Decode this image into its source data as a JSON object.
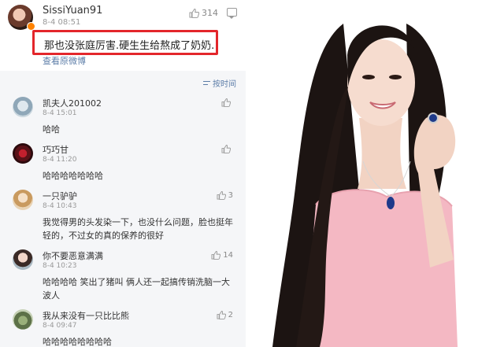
{
  "post": {
    "username": "SissiYuan91",
    "date": "8-4 08:51",
    "likes": "314",
    "content": "那也没张庭厉害.硬生生给熬成了奶奶.",
    "view_original": "查看原微博"
  },
  "sort": {
    "label": "按时间"
  },
  "comments": [
    {
      "name": "凯夫人201002",
      "date": "8-4 15:01",
      "text": "哈哈",
      "likes": ""
    },
    {
      "name": "巧巧甘",
      "date": "8-4 11:20",
      "text": "哈哈哈哈哈哈哈",
      "likes": ""
    },
    {
      "name": "一只驴驴",
      "date": "8-4 10:43",
      "text": "我觉得男的头发染一下，也没什么问题，脸也挺年轻的，不过女的真的保养的很好",
      "likes": "3"
    },
    {
      "name": "你不要恶意满满",
      "date": "8-4 10:23",
      "text": "哈哈哈哈 笑出了猪叫 俩人还一起搞传销洗脑一大波人",
      "likes": "14"
    },
    {
      "name": "我从来没有一只比比熊",
      "date": "8-4 09:47",
      "text": "哈哈哈哈哈哈哈哈",
      "likes": "2"
    }
  ],
  "colors": {
    "highlight_box": "#e3262b",
    "link": "#5b7ca7",
    "comments_bg": "#f5f6f8",
    "dress_pink": "#f4b8c3"
  }
}
